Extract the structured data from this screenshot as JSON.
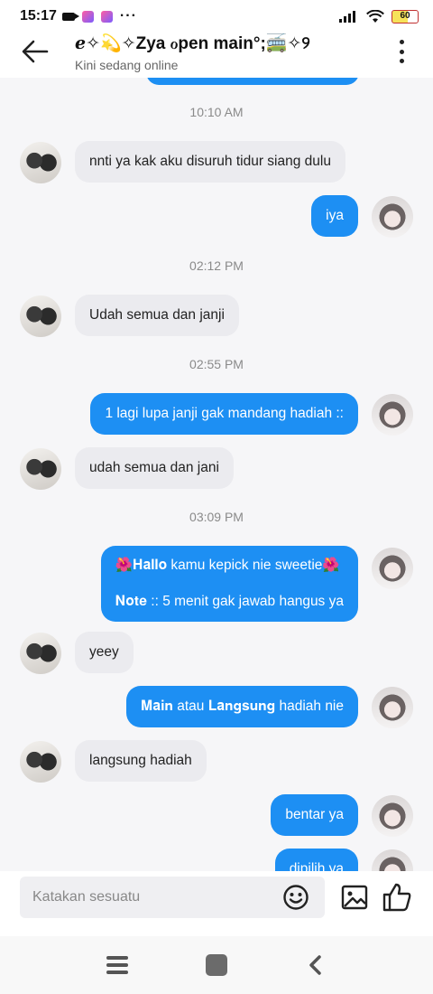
{
  "status_bar": {
    "time": "15:17",
    "overflow": "···",
    "battery": "60"
  },
  "header": {
    "title": "ℯ✧💫✧Zya ℴpen main°;🚎✧୨",
    "status": "Kini sedang online"
  },
  "messages": [
    {
      "kind": "time",
      "text": "10:10 AM"
    },
    {
      "kind": "in",
      "text": "nnti ya kak aku disuruh tidur siang dulu"
    },
    {
      "kind": "out",
      "text": "iya"
    },
    {
      "kind": "time",
      "text": "02:12 PM"
    },
    {
      "kind": "in",
      "text": "Udah semua dan janji"
    },
    {
      "kind": "time",
      "text": "02:55 PM"
    },
    {
      "kind": "out",
      "text": "1 lagi lupa janji gak mandang hadiah ::"
    },
    {
      "kind": "in",
      "text": "udah semua dan jani"
    },
    {
      "kind": "time",
      "text": "03:09 PM"
    },
    {
      "kind": "out",
      "line1": "🌺𝐇𝐚𝐥𝐥𝐨 kamu kepick nie sweetie🌺",
      "line2": "𝐍𝐨𝐭𝐞 :: 5 menit gak jawab hangus ya"
    },
    {
      "kind": "in",
      "text": "yeey"
    },
    {
      "kind": "out",
      "text": "𝐌𝐚𝐢𝐧 atau 𝐋𝐚𝐧𝐠𝐬𝐮𝐧𝐠 hadiah nie"
    },
    {
      "kind": "in",
      "text": "langsung hadiah"
    },
    {
      "kind": "out",
      "text": "bentar ya"
    },
    {
      "kind": "out",
      "text": "dipilih ya"
    }
  ],
  "input": {
    "placeholder": "Katakan sesuatu"
  },
  "icons": {
    "back": "arrow-left-icon",
    "menu": "kebab-menu-icon",
    "emoji": "smiley-icon",
    "image": "image-icon",
    "like": "thumbs-up-icon",
    "nav_menu": "menu-icon",
    "nav_home": "home-icon",
    "nav_back": "chevron-left-icon"
  },
  "colors": {
    "accent": "#1d8ff3",
    "incoming_bubble": "#ebebef",
    "chat_bg": "#f6f6f8"
  }
}
